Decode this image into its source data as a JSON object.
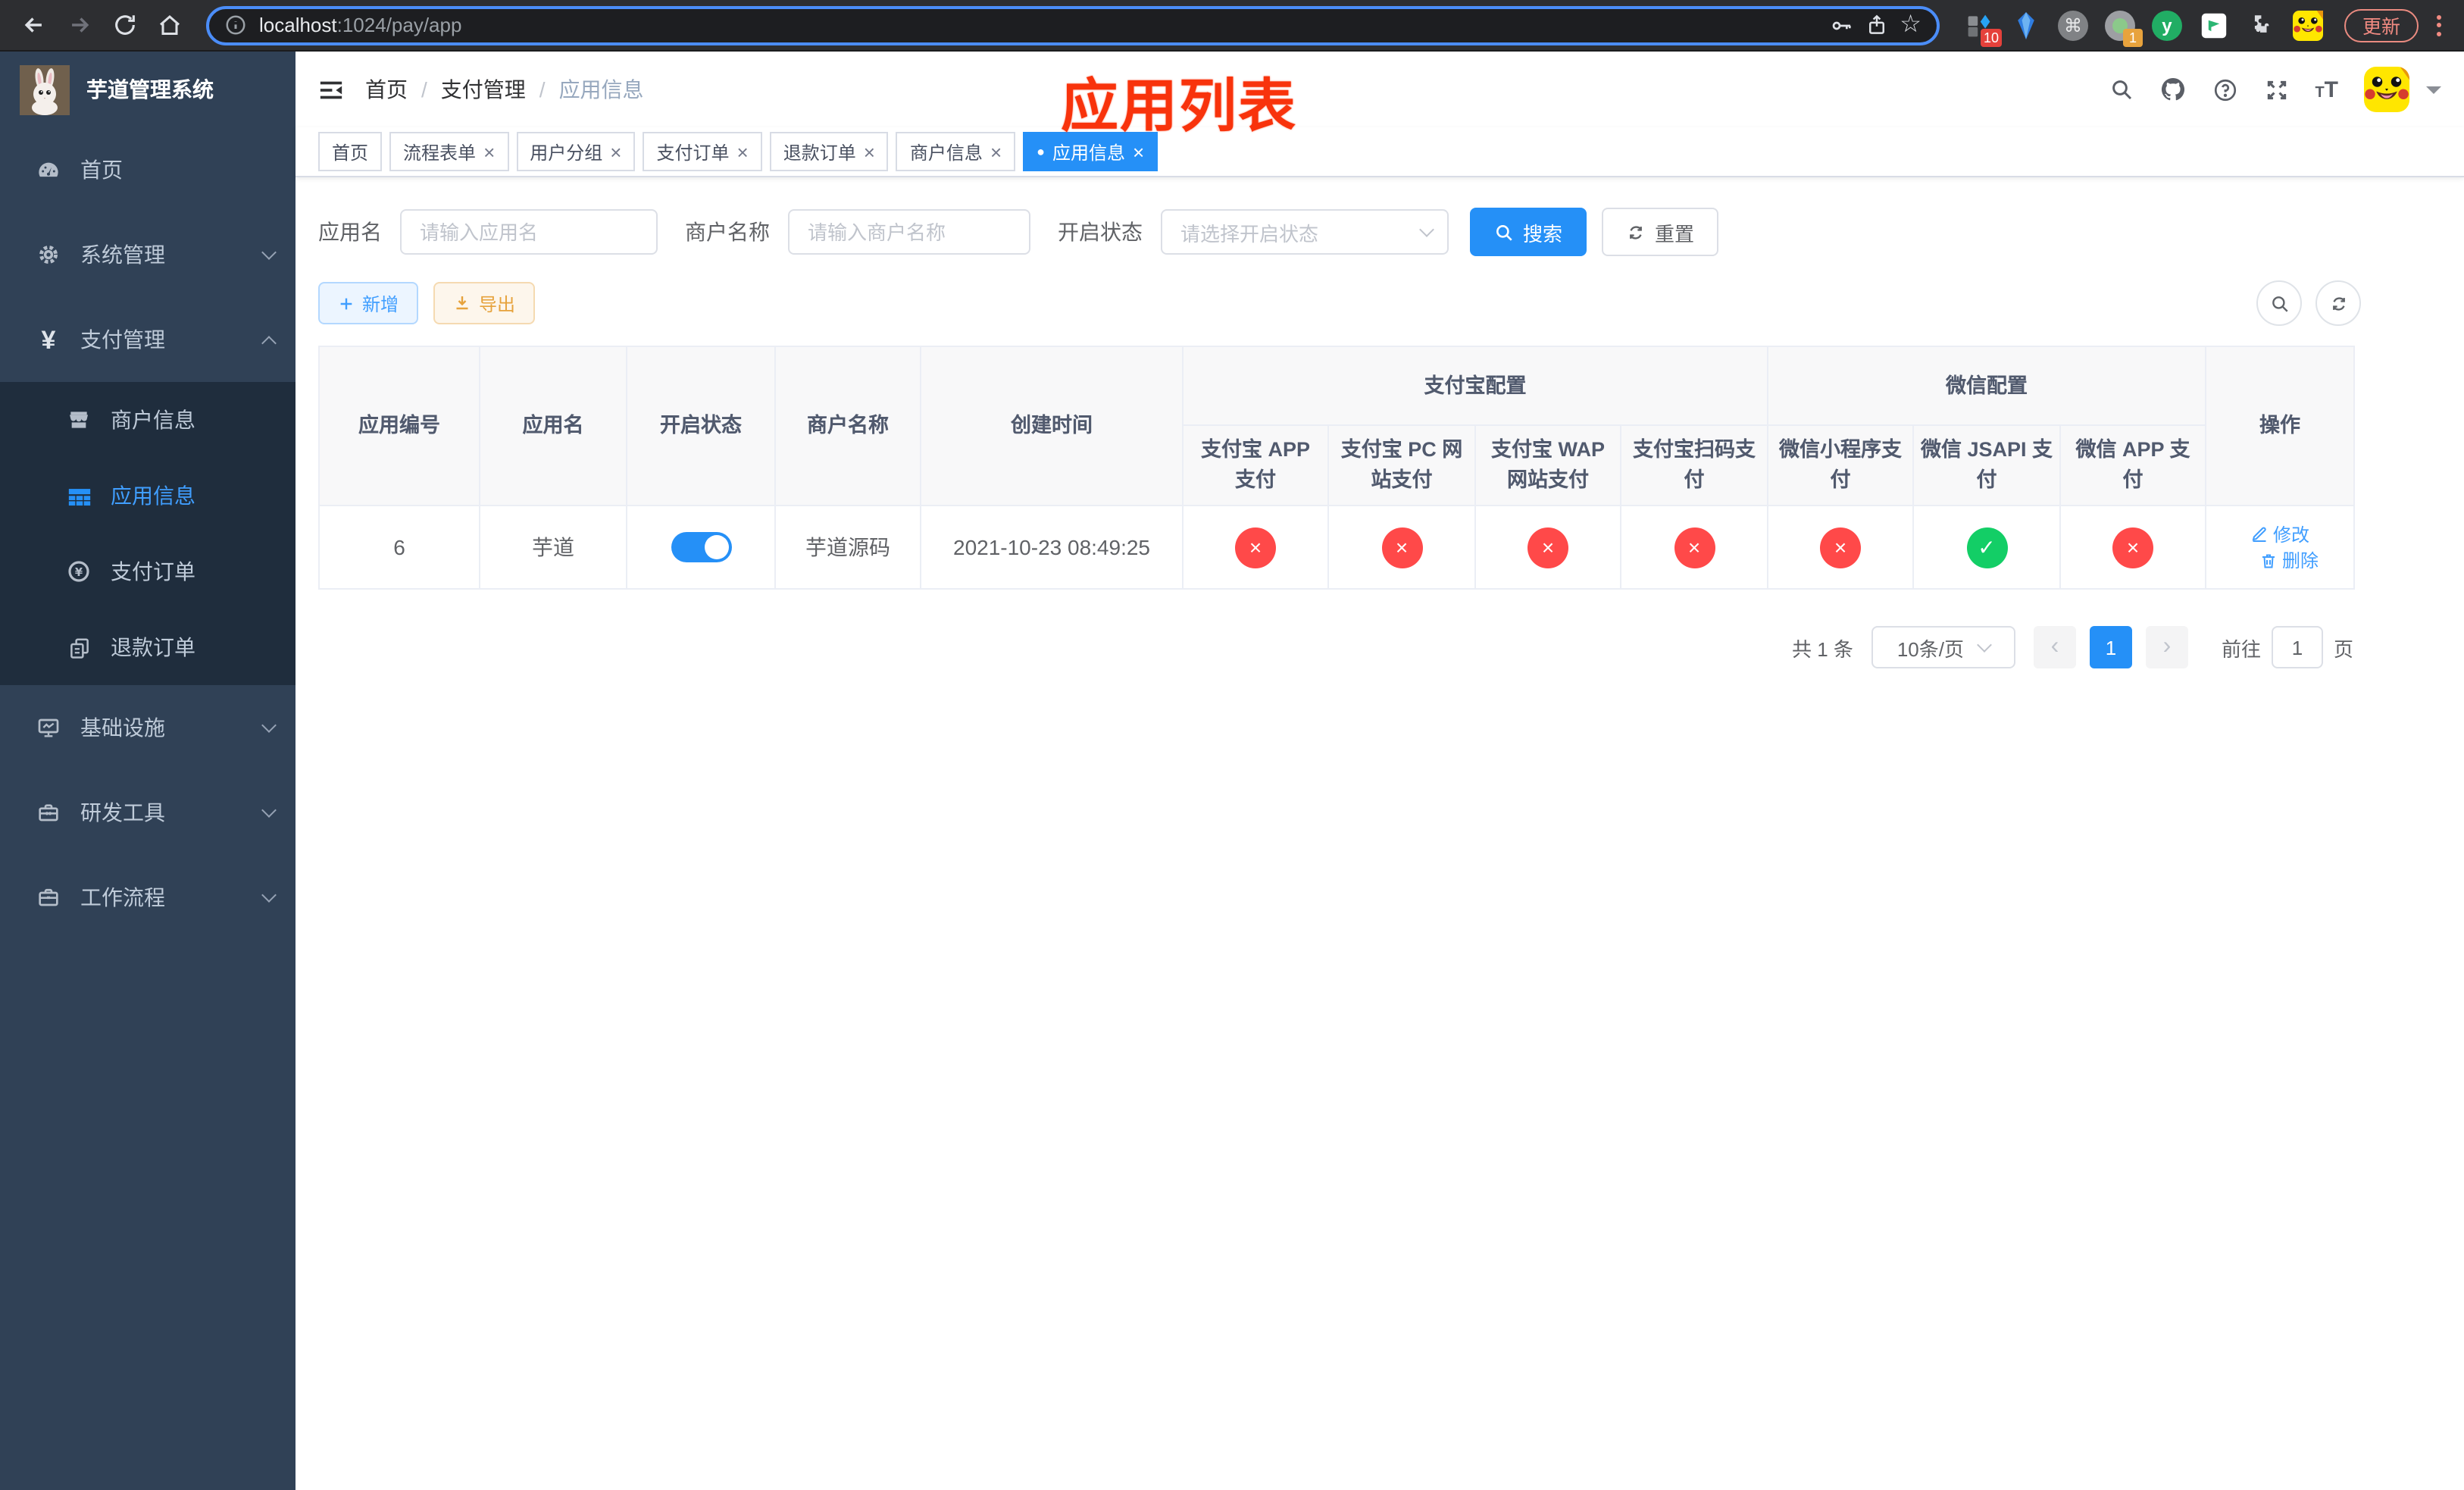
{
  "browser": {
    "url_host": "localhost",
    "url_path": ":1024/pay/app",
    "update_label": "更新",
    "ext1_badge": "10",
    "ext4_badge": "1"
  },
  "sidebar": {
    "logo_title": "芋道管理系统",
    "home": "首页",
    "system": "系统管理",
    "payment": "支付管理",
    "merchant_info": "商户信息",
    "app_info": "应用信息",
    "pay_order": "支付订单",
    "refund_order": "退款订单",
    "infra": "基础设施",
    "dev_tools": "研发工具",
    "workflow": "工作流程"
  },
  "navbar": {
    "breadcrumb": [
      "首页",
      "支付管理",
      "应用信息"
    ],
    "separator": "/"
  },
  "annotation": "应用列表",
  "tabs": [
    {
      "label": "首页"
    },
    {
      "label": "流程表单"
    },
    {
      "label": "用户分组"
    },
    {
      "label": "支付订单"
    },
    {
      "label": "退款订单"
    },
    {
      "label": "商户信息"
    },
    {
      "label": "应用信息"
    }
  ],
  "filter": {
    "app_name_label": "应用名",
    "app_name_placeholder": "请输入应用名",
    "merchant_label": "商户名称",
    "merchant_placeholder": "请输入商户名称",
    "status_label": "开启状态",
    "status_placeholder": "请选择开启状态",
    "search_label": "搜索",
    "reset_label": "重置"
  },
  "toolbar": {
    "add_label": "新增",
    "export_label": "导出"
  },
  "table": {
    "headers": {
      "id": "应用编号",
      "name": "应用名",
      "status": "开启状态",
      "merchant": "商户名称",
      "created": "创建时间",
      "alipay_group": "支付宝配置",
      "wechat_group": "微信配置",
      "alipay_app": "支付宝 APP 支付",
      "alipay_pc": "支付宝 PC 网站支付",
      "alipay_wap": "支付宝 WAP 网站支付",
      "alipay_qr": "支付宝扫码支付",
      "wechat_mini": "微信小程序支付",
      "wechat_jsapi": "微信 JSAPI 支付",
      "wechat_app": "微信 APP 支付",
      "actions": "操作"
    },
    "row": {
      "id": "6",
      "name": "芋道",
      "merchant": "芋道源码",
      "created": "2021-10-23 08:49:25",
      "switch_on": true,
      "alipay_app": "disabled",
      "alipay_pc": "disabled",
      "alipay_wap": "disabled",
      "alipay_qr": "disabled",
      "wechat_mini": "disabled",
      "wechat_jsapi": "enabled",
      "wechat_app": "disabled",
      "edit_label": "修改",
      "delete_label": "删除"
    }
  },
  "pagination": {
    "total": "共 1 条",
    "page_size": "10条/页",
    "current_page": "1",
    "jump_prefix": "前往",
    "jump_value": "1",
    "jump_suffix": "页"
  },
  "icons": {
    "close": "×",
    "active_dot": "●",
    "check": "✓",
    "cross": "×",
    "prev": "‹",
    "next": "›",
    "star": "☆",
    "command": "⌘",
    "yen": "¥"
  },
  "colors": {
    "primary_solid": "#2590f7",
    "link": "#409eff",
    "success": "#13ce66",
    "danger": "#ff4949",
    "sidebar_bg": "#304156",
    "submenu_bg": "#1f2d3d"
  }
}
